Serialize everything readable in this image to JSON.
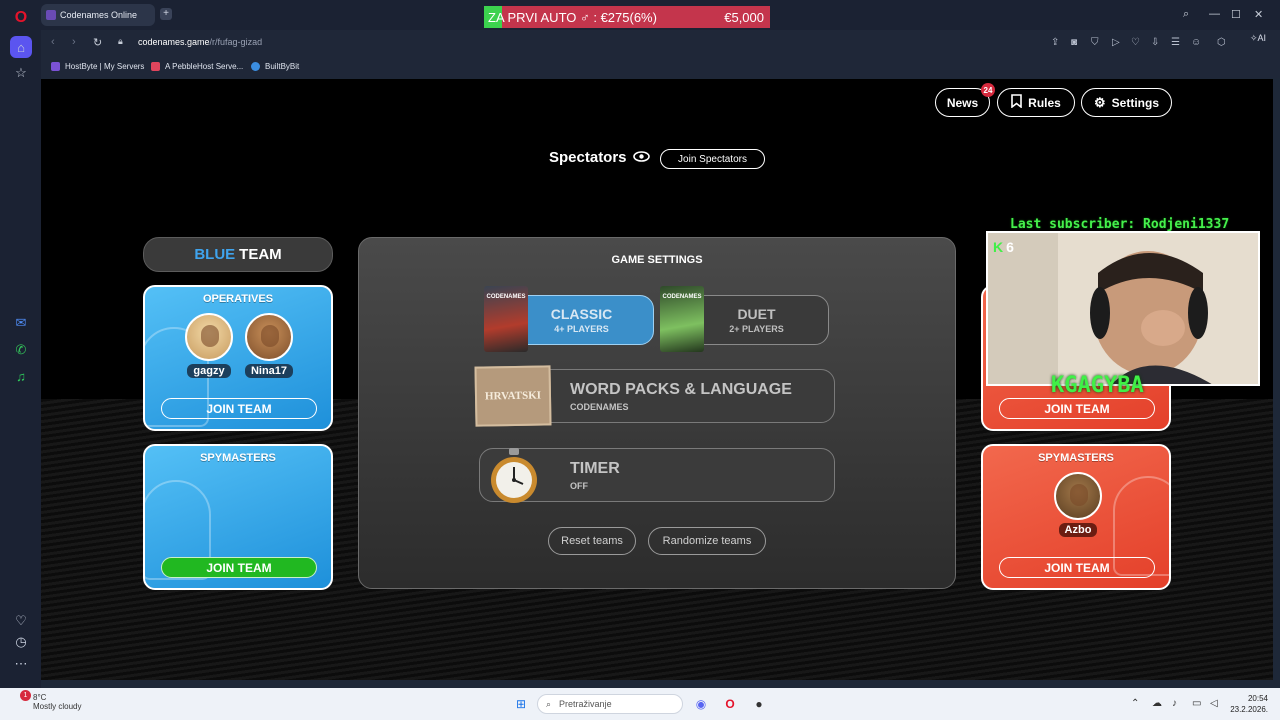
{
  "browser": {
    "tab_title": "Codenames Online",
    "promo": {
      "text": "ZA PRVI AUTO  ♂ : €275(6%)",
      "price": "€5,000"
    },
    "url_host": "codenames.game",
    "url_path": "/r/fufag-gizad",
    "ai_label": "Aria AI",
    "bookmarks": [
      "HostByte | My Servers",
      "A PebbleHost Serve...",
      "BuiltByBit"
    ]
  },
  "nav": {
    "news": "News",
    "news_badge": "24",
    "rules": "Rules",
    "settings": "Settings"
  },
  "spectators": {
    "label": "Spectators",
    "join": "Join Spectators"
  },
  "blue_team": {
    "title_color": "BLUE",
    "title_rest": "TEAM",
    "operatives_title": "OPERATIVES",
    "operatives": [
      "gagzy",
      "Nina17"
    ],
    "join_operatives": "JOIN TEAM",
    "spymasters_title": "SPYMASTERS",
    "join_spymasters": "JOIN TEAM"
  },
  "red_team": {
    "join_operatives": "JOIN TEAM",
    "spymasters_title": "SPYMASTERS",
    "spymasters": [
      "Azbo"
    ],
    "join_spymasters": "JOIN TEAM"
  },
  "game_settings": {
    "title": "GAME SETTINGS",
    "modes": [
      {
        "name": "CLASSIC",
        "sub": "4+ PLAYERS",
        "selected": true
      },
      {
        "name": "DUET",
        "sub": "2+ PLAYERS",
        "selected": false
      }
    ],
    "word_packs": {
      "name": "WORD PACKS & LANGUAGE",
      "sub": "CODENAMES",
      "card_label": "HRVATSKI"
    },
    "timer": {
      "name": "TIMER",
      "sub": "OFF"
    },
    "reset": "Reset teams",
    "randomize": "Randomize teams",
    "box_labels": {
      "classic": "CODENAMES",
      "duet": "CODENAMES"
    }
  },
  "stream_overlay": {
    "last_subscriber": "Last subscriber: Rodjeni1337",
    "k_count": "6",
    "tag": "KGAGYBA"
  },
  "taskbar": {
    "temp": "8°C",
    "weather": "Mostly cloudy",
    "weather_badge": "1",
    "search": "Pretraživanje",
    "time": "20:54",
    "date": "23.2.2026."
  },
  "colors": {
    "blue": "#3fa4ee",
    "red": "#e4402a",
    "green": "#21b821",
    "accent": "#5b55f0"
  }
}
